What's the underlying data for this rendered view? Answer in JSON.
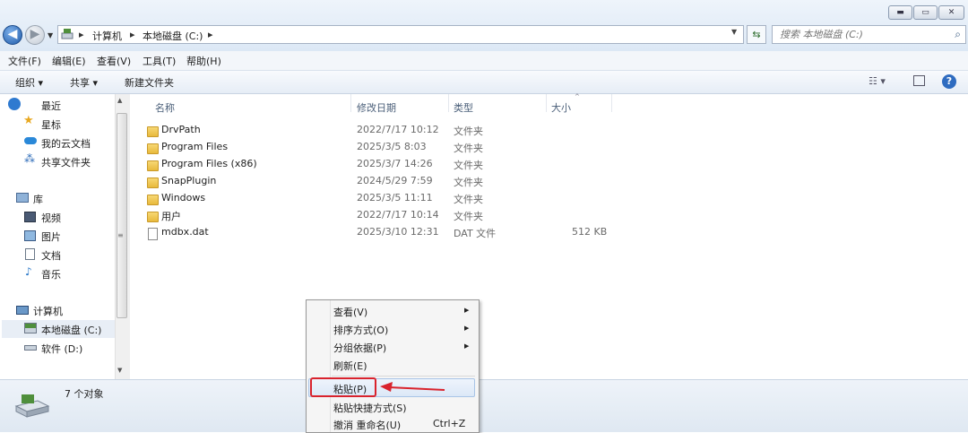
{
  "window": {
    "min_glyph": "▬",
    "max_glyph": "▭",
    "close_glyph": "✕"
  },
  "address": {
    "crumbs": [
      "计算机",
      "本地磁盘 (C:)"
    ],
    "separator": "▸"
  },
  "search": {
    "placeholder": "搜索 本地磁盘 (C:)"
  },
  "menubar": [
    "文件(F)",
    "编辑(E)",
    "查看(V)",
    "工具(T)",
    "帮助(H)"
  ],
  "toolbar": {
    "organize": "组织 ▾",
    "share": "共享 ▾",
    "new_folder": "新建文件夹"
  },
  "nav": {
    "favorites": [
      "最近",
      "星标",
      "我的云文档",
      "共享文件夹"
    ],
    "library_header": "库",
    "library": [
      "视频",
      "图片",
      "文档",
      "音乐"
    ],
    "computer_header": "计算机",
    "drives": [
      "本地磁盘 (C:)",
      "软件 (D:)"
    ]
  },
  "columns": {
    "name": "名称",
    "date": "修改日期",
    "type": "类型",
    "size": "大小"
  },
  "files": [
    {
      "name": "DrvPath",
      "date": "2022/7/17 10:12",
      "type": "文件夹",
      "size": "",
      "icon": "folder-icon"
    },
    {
      "name": "Program Files",
      "date": "2025/3/5 8:03",
      "type": "文件夹",
      "size": "",
      "icon": "folder-icon"
    },
    {
      "name": "Program Files (x86)",
      "date": "2025/3/7 14:26",
      "type": "文件夹",
      "size": "",
      "icon": "folder-icon"
    },
    {
      "name": "SnapPlugin",
      "date": "2024/5/29 7:59",
      "type": "文件夹",
      "size": "",
      "icon": "folder-icon"
    },
    {
      "name": "Windows",
      "date": "2025/3/5 11:11",
      "type": "文件夹",
      "size": "",
      "icon": "folder-icon"
    },
    {
      "name": "用户",
      "date": "2022/7/17 10:14",
      "type": "文件夹",
      "size": "",
      "icon": "folder-icon"
    },
    {
      "name": "mdbx.dat",
      "date": "2025/3/10 12:31",
      "type": "DAT 文件",
      "size": "512 KB",
      "icon": "file-icon"
    }
  ],
  "status": {
    "count": "7 个对象"
  },
  "context_menu": {
    "items": [
      {
        "label": "查看(V)",
        "submenu": true
      },
      {
        "label": "排序方式(O)",
        "submenu": true
      },
      {
        "label": "分组依据(P)",
        "submenu": true
      },
      {
        "label": "刷新(E)",
        "submenu": false
      },
      {
        "label": "粘贴(P)",
        "submenu": false,
        "highlighted": true
      },
      {
        "label": "粘贴快捷方式(S)",
        "submenu": false
      },
      {
        "label": "撤消 重命名(U)",
        "submenu": false,
        "shortcut": "Ctrl+Z"
      }
    ]
  },
  "colors": {
    "annotation_red": "#d9232d",
    "link_blue": "#1f5aa8"
  }
}
